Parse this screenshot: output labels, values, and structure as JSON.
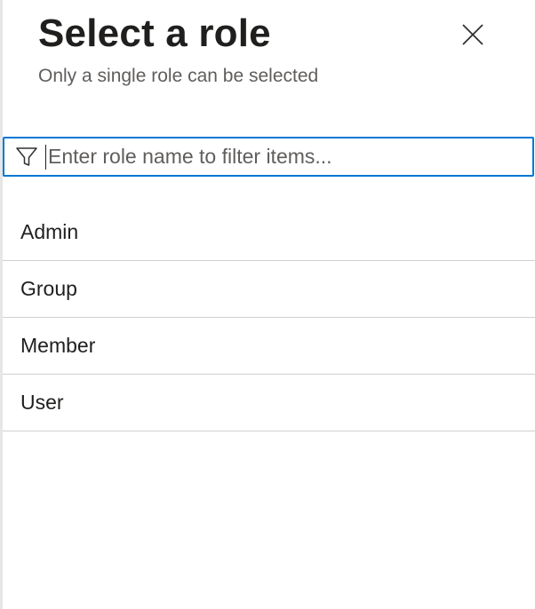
{
  "panel": {
    "title": "Select a role",
    "subtitle": "Only a single role can be selected",
    "close_icon": "close-icon"
  },
  "filter": {
    "icon": "filter-icon",
    "value": "",
    "placeholder": "Enter role name to filter items..."
  },
  "roles": {
    "items": [
      {
        "label": "Admin"
      },
      {
        "label": "Group"
      },
      {
        "label": "Member"
      },
      {
        "label": "User"
      }
    ]
  },
  "colors": {
    "accent": "#0078d4",
    "divider": "#d2d0ce",
    "text": "#201f1e",
    "subtext": "#605e5c"
  }
}
